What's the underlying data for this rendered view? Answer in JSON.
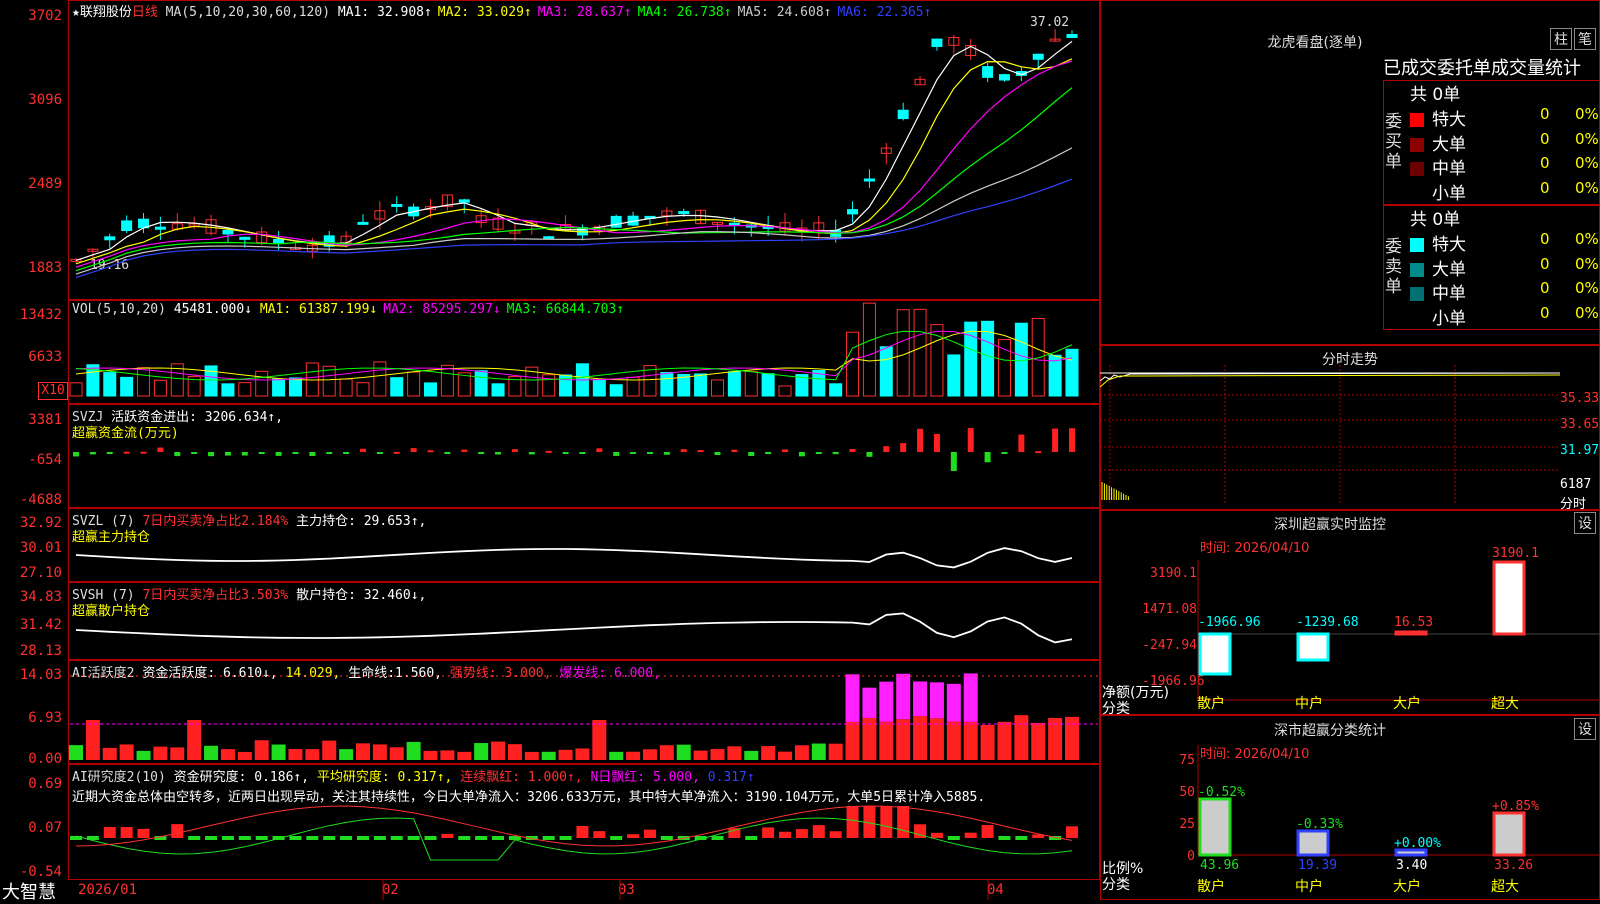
{
  "stock": {
    "name": "★联翔股份",
    "period": "日线",
    "ma_header": "MA(5,10,20,30,60,120)",
    "ma_items": [
      {
        "label": "MA1:",
        "value": "32.908↑",
        "color": "#ffffff"
      },
      {
        "label": "MA2:",
        "value": "33.029↑",
        "color": "#ffff00"
      },
      {
        "label": "MA3:",
        "value": "28.637↑",
        "color": "#ff00ff"
      },
      {
        "label": "MA4:",
        "value": "26.738↑",
        "color": "#00ff00"
      },
      {
        "label": "MA5:",
        "value": "24.608↑",
        "color": "#cccccc"
      },
      {
        "label": "MA6:",
        "value": "22.365↑",
        "color": "#3040ff"
      }
    ],
    "price_ticks": [
      "3702",
      "3096",
      "2489",
      "1883"
    ],
    "high_label": "37.02",
    "low_label": "19.16"
  },
  "vol": {
    "header": "VOL(5,10,20)",
    "value": "45481.000↓",
    "ma_items": [
      {
        "label": "MA1:",
        "value": "61387.199↓",
        "color": "#ffff00"
      },
      {
        "label": "MA2:",
        "value": "85295.297↓",
        "color": "#ff00ff"
      },
      {
        "label": "MA3:",
        "value": "66844.703↑",
        "color": "#00ff00"
      }
    ],
    "ticks": [
      "13432",
      "6633"
    ],
    "unit": "X10"
  },
  "svzj": {
    "header": "SVZJ",
    "label": "活跃资金进出:",
    "value": "3206.634↑,",
    "sub": "超赢资金流(万元)",
    "ticks": [
      "3381",
      "-654",
      "-4688"
    ]
  },
  "svzl": {
    "header": "SVZL (7)",
    "note": "7日内买卖净占比2.184%",
    "label": "主力持仓:",
    "value": "29.653↑,",
    "sub": "超赢主力持仓",
    "ticks": [
      "32.92",
      "30.01",
      "27.10"
    ]
  },
  "svsh": {
    "header": "SVSH (7)",
    "note": "7日内买卖净占比3.503%",
    "label": "散户持仓:",
    "value": "32.460↓,",
    "sub": "超赢散户持仓",
    "ticks": [
      "34.83",
      "31.42",
      "28.13"
    ]
  },
  "ai_active": {
    "header": "AI活跃度2",
    "label": "资金活跃度:",
    "value": "6.610↓,",
    "v2": "14.029,",
    "life_label": "生命线:",
    "life": "1.560,",
    "strong": "强势线: 3.000,",
    "burst": "爆发线: 6.000,",
    "ticks": [
      "14.03",
      "6.93",
      "0.00"
    ]
  },
  "ai_research": {
    "header": "AI研究度2(10)",
    "label": "资金研究度:",
    "value": "0.186↑,",
    "avg": "平均研究度: 0.317↑,",
    "cont": "连续飘红: 1.000↑,",
    "nday": "N日飘红: 5.000,",
    "last": "0.317↑",
    "text": "近期大资金总体由空转多，近两日出现异动，关注其持续性，今日大单净流入：3206.633万元，其中特大单净流入：3190.104万元，大单5日累计净入5885.",
    "ticks": [
      "0.69",
      "0.07",
      "-0.54"
    ]
  },
  "xaxis": {
    "labels": [
      "2026/01",
      "02",
      "03",
      "04"
    ]
  },
  "brand": "大智慧",
  "lhb": {
    "title": "龙虎看盘(逐单)",
    "btn1": "柱",
    "btn2": "笔",
    "subtitle": "已成交委托单成交量统计",
    "buy_side": "委买单",
    "sell_side": "委卖单",
    "buy_total": "共 0单",
    "sell_total": "共 0单",
    "buy_rows": [
      {
        "label": "特大",
        "n": "0",
        "p": "0%",
        "color": "#ff0000"
      },
      {
        "label": "大单",
        "n": "0",
        "p": "0%",
        "color": "#8b0000"
      },
      {
        "label": "中单",
        "n": "0",
        "p": "0%",
        "color": "#6b0000"
      },
      {
        "label": "小单",
        "n": "0",
        "p": "0%",
        "color": "#000000"
      }
    ],
    "sell_rows": [
      {
        "label": "特大",
        "n": "0",
        "p": "0%",
        "color": "#00ffff"
      },
      {
        "label": "大单",
        "n": "0",
        "p": "0%",
        "color": "#008b8b"
      },
      {
        "label": "中单",
        "n": "0",
        "p": "0%",
        "color": "#007070"
      },
      {
        "label": "小单",
        "n": "0",
        "p": "0%",
        "color": "#000000"
      }
    ]
  },
  "fenshi": {
    "title": "分时走势",
    "ticks": [
      "35.33",
      "33.65",
      "31.97",
      "6187"
    ],
    "unit": "分时"
  },
  "sz_monitor": {
    "title": "深圳超赢实时监控",
    "btn": "设",
    "time": "时间: 2026/04/10",
    "ticks": [
      "3190.1",
      "1471.08",
      "-247.94",
      "-1966.96"
    ],
    "ylabel": "净额(万元)",
    "xlabel": "分类",
    "bars": [
      {
        "label": "散户",
        "value": "-1966.96"
      },
      {
        "label": "中户",
        "value": "-1239.68"
      },
      {
        "label": "大户",
        "value": "16.53"
      },
      {
        "label": "超大",
        "value": "3190.1"
      }
    ]
  },
  "sz_class": {
    "title": "深市超赢分类统计",
    "btn": "设",
    "time": "时间: 2026/04/10",
    "ticks": [
      "75",
      "50",
      "25",
      "0"
    ],
    "ylabel": "比例%",
    "xlabel": "分类",
    "bars": [
      {
        "label": "散户",
        "change": "-0.52%",
        "value": "43.96"
      },
      {
        "label": "中户",
        "change": "-0.33%",
        "value": "19.39"
      },
      {
        "label": "大户",
        "change": "+0.00%",
        "value": "3.40"
      },
      {
        "label": "超大",
        "change": "+0.85%",
        "value": "33.26"
      }
    ]
  }
}
